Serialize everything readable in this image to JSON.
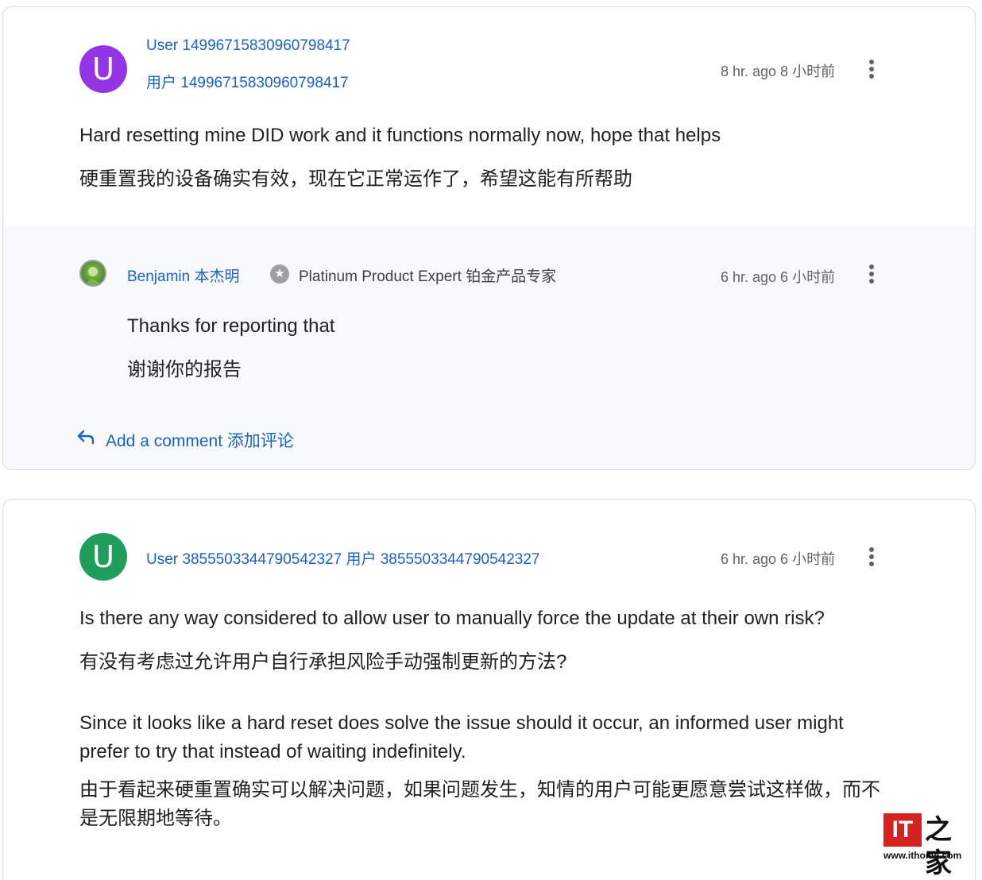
{
  "posts": [
    {
      "avatar_letter": "U",
      "avatar_color": "#9334e6",
      "user_line1": "User 1499671583096079841 7",
      "user_line1_text": "User 14996715830960798417",
      "user_line2": "用户 14996715830960798417",
      "time": "8 hr. ago 8 小时前",
      "body_en": "Hard resetting mine DID work and it functions normally now, hope that helps",
      "body_zh": "硬重置我的设备确实有效，现在它正常运作了，希望这能有所帮助",
      "reply": {
        "name": "Benjamin  本杰明",
        "badge": "Platinum Product Expert 铂金产品专家",
        "time": "6 hr. ago 6 小时前",
        "body_en": "Thanks for reporting that",
        "body_zh": "谢谢你的报告"
      },
      "add_comment": "Add a comment 添加评论"
    },
    {
      "avatar_letter": "U",
      "avatar_color": "#1e9e5a",
      "user_line": "User 3855503344790542327 用户 3855503344790542327",
      "time": "6 hr. ago 6 小时前",
      "body_en_1": "Is there any way considered to allow user to manually force the update at their own risk?",
      "body_zh_1": "有没有考虑过允许用户自行承担风险手动强制更新的方法?",
      "body_en_2": "Since it looks like a hard reset does solve the issue should it occur, an informed user might prefer to try that instead of waiting indefinitely.",
      "body_zh_2": "由于看起来硬重置确实可以解决问题，如果问题发生，知情的用户可能更愿意尝试这样做，而不是无限期地等待。"
    }
  ],
  "watermark": {
    "logo_text": "IT之家",
    "url": "www.ithome.com",
    "brand_color": "#d22222"
  },
  "icons": {
    "kebab": "more-vert-icon",
    "reply": "reply-arrow-icon",
    "badge": "expert-star-icon"
  }
}
